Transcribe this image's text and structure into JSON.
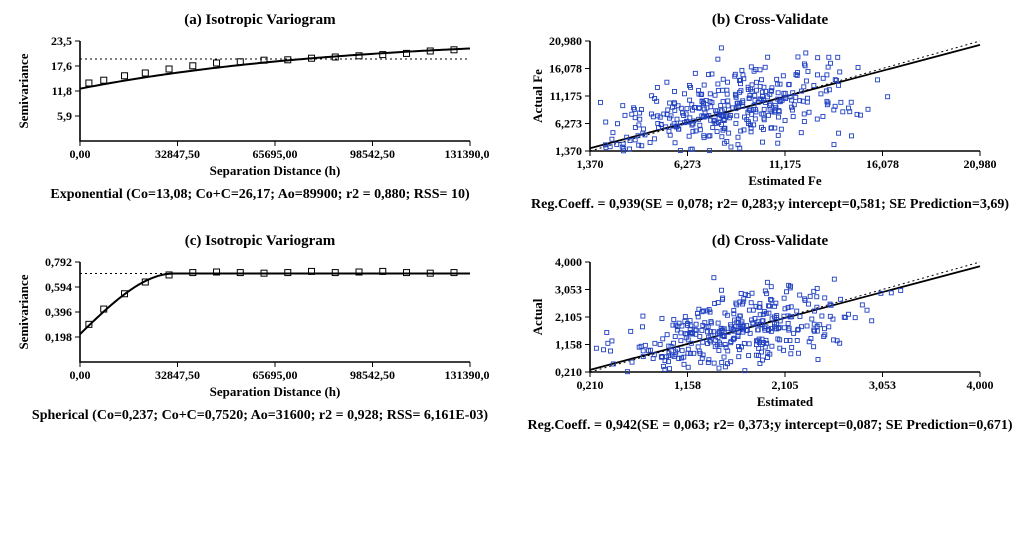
{
  "panel_a": {
    "title": "(a) Isotropic Variogram",
    "xlabel": "Separation Distance (h)",
    "ylabel": "Semivariance",
    "xticks": [
      "0,00",
      "32847,50",
      "65695,00",
      "98542,50",
      "131390,00"
    ],
    "yticks": [
      "5,9",
      "11,8",
      "17,6",
      "23,5"
    ],
    "caption": "Exponential (Co=13,08; Co+C=26,17; Ao=89900; r2 = 0,880; RSS= 10)"
  },
  "panel_b": {
    "title": "(b) Cross-Validate",
    "xlabel": "Estimated Fe",
    "ylabel": "Actual Fe",
    "xticks": [
      "1,370",
      "6,273",
      "11,175",
      "16,078",
      "20,980"
    ],
    "yticks": [
      "1,370",
      "6,273",
      "11,175",
      "16,078",
      "20,980"
    ],
    "caption": "Reg.Coeff. = 0,939(SE = 0,078; r2= 0,283;y intercept=0,581; SE Prediction=3,69)"
  },
  "panel_c": {
    "title": "(c) Isotropic Variogram",
    "xlabel": "Separation Distance (h)",
    "ylabel": "Semivariance",
    "xticks": [
      "0,00",
      "32847,50",
      "65695,00",
      "98542,50",
      "131390,00"
    ],
    "yticks": [
      "0,198",
      "0,396",
      "0,594",
      "0,792"
    ],
    "caption": "Spherical (Co=0,237; Co+C=0,7520; Ao=31600; r2 = 0,928; RSS= 6,161E-03)"
  },
  "panel_d": {
    "title": "(d) Cross-Validate",
    "xlabel": "Estimated",
    "ylabel": "Actual",
    "xticks": [
      "0,210",
      "1,158",
      "2,105",
      "3,053",
      "4,000"
    ],
    "yticks": [
      "0,210",
      "1,158",
      "2,105",
      "3,053",
      "4,000"
    ],
    "caption": "Reg.Coeff. = 0,942(SE = 0,063; r2= 0,373;y intercept=0,087; SE Prediction=0,671)"
  },
  "chart_data": [
    {
      "id": "a",
      "type": "variogram",
      "model": "Exponential",
      "Co": 13.08,
      "CoC": 26.17,
      "Ao": 89900,
      "r2": 0.88,
      "rss": 10,
      "xlim": [
        0,
        131390
      ],
      "ylim": [
        0,
        25.0
      ],
      "sill_line": 20.5,
      "points_x": [
        3000,
        8000,
        15000,
        22000,
        30000,
        38000,
        46000,
        54000,
        62000,
        70000,
        78000,
        86000,
        94000,
        102000,
        110000,
        118000,
        126000
      ],
      "points_y": [
        14.5,
        15.2,
        16.3,
        17.0,
        18.0,
        18.8,
        19.5,
        19.8,
        20.2,
        20.3,
        20.7,
        21.0,
        21.3,
        21.6,
        21.9,
        22.5,
        22.8
      ]
    },
    {
      "id": "b",
      "type": "scatter",
      "xlim": [
        1.37,
        20.98
      ],
      "ylim": [
        1.37,
        20.98
      ],
      "reg_intercept": 0.581,
      "reg_slope": 0.939,
      "cloud_center": [
        8.7,
        8.8
      ],
      "cloud_spread": [
        3.0,
        3.5
      ],
      "n_points": 380
    },
    {
      "id": "c",
      "type": "variogram",
      "model": "Spherical",
      "Co": 0.237,
      "CoC": 0.752,
      "Ao": 31600,
      "r2": 0.928,
      "rss": 0.006161,
      "xlim": [
        0,
        131390
      ],
      "ylim": [
        0,
        0.85
      ],
      "sill_line": 0.752,
      "points_x": [
        3000,
        8000,
        15000,
        22000,
        30000,
        38000,
        46000,
        54000,
        62000,
        70000,
        78000,
        86000,
        94000,
        102000,
        110000,
        118000,
        126000
      ],
      "points_y": [
        0.32,
        0.45,
        0.58,
        0.68,
        0.74,
        0.76,
        0.765,
        0.76,
        0.755,
        0.76,
        0.77,
        0.76,
        0.765,
        0.77,
        0.76,
        0.755,
        0.76
      ]
    },
    {
      "id": "d",
      "type": "scatter",
      "xlim": [
        0.21,
        4.0
      ],
      "ylim": [
        0.21,
        4.0
      ],
      "reg_intercept": 0.087,
      "reg_slope": 0.942,
      "cloud_center": [
        1.63,
        1.63
      ],
      "cloud_spread": [
        0.55,
        0.7
      ],
      "n_points": 380
    }
  ]
}
